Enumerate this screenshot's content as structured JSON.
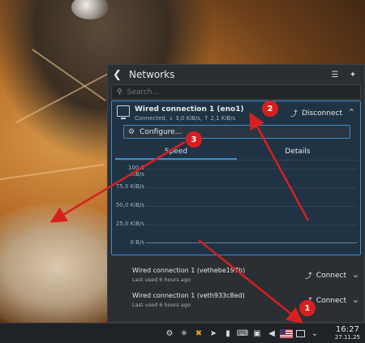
{
  "popup": {
    "title": "Networks",
    "search_placeholder": "Search..."
  },
  "active_connection": {
    "name": "Wired connection 1 (eno1)",
    "status": "Connected, ↓ 3,0 KiB/s, ↑ 2,1 KiB/s",
    "action_label": "Disconnect",
    "configure_label": "Configure...",
    "tabs": [
      {
        "label": "Speed"
      },
      {
        "label": "Details"
      }
    ],
    "graph": {
      "y_labels": [
        "100,0 KiB/s",
        "75,0 KiB/s",
        "50,0 KiB/s",
        "25,0 KiB/s",
        "0 B/s"
      ]
    }
  },
  "other_connections": [
    {
      "name": "Wired connection 1 (vethebe197b)",
      "subtitle": "Last used 6 hours ago",
      "action_label": "Connect"
    },
    {
      "name": "Wired connection 1 (veth933c8ed)",
      "subtitle": "Last used 6 hours ago",
      "action_label": "Connect"
    }
  ],
  "taskbar": {
    "time": "16:27",
    "date": "27.11.25"
  },
  "annotations": [
    {
      "label": "1"
    },
    {
      "label": "2"
    },
    {
      "label": "3"
    }
  ],
  "colors": {
    "accent": "#3d8ec9",
    "annotation": "#d81f1f",
    "panel_bg": "#2b2f34"
  }
}
